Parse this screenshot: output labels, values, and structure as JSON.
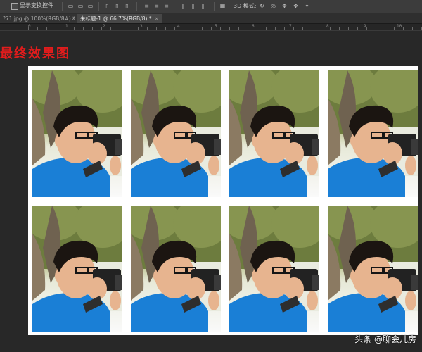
{
  "options_bar": {
    "show_transform_label": "显示变换控件",
    "mode_label": "3D 模式:"
  },
  "tabs": [
    {
      "label": "?71.jpg @ 100%(RGB/8#) *",
      "close": "×"
    },
    {
      "label": "未标题-1 @ 66.7%(RGB/8) *",
      "close": "×"
    }
  ],
  "ruler": {
    "labels": [
      "0",
      "1",
      "2",
      "3",
      "4",
      "5",
      "6",
      "7",
      "8",
      "9",
      "10"
    ]
  },
  "canvas": {
    "heading": "最终效果图",
    "watermark": "头条 @聊会儿房"
  },
  "photo_sheet": {
    "rows": 2,
    "cols": 4,
    "photo_count": 8,
    "colors": {
      "shirt": "#1a7fd6",
      "hair": "#1b1511",
      "skin": "#e7b48f",
      "camera": "#222222",
      "foliage": "#6d7c3e",
      "bark": "#8b7a62"
    }
  }
}
